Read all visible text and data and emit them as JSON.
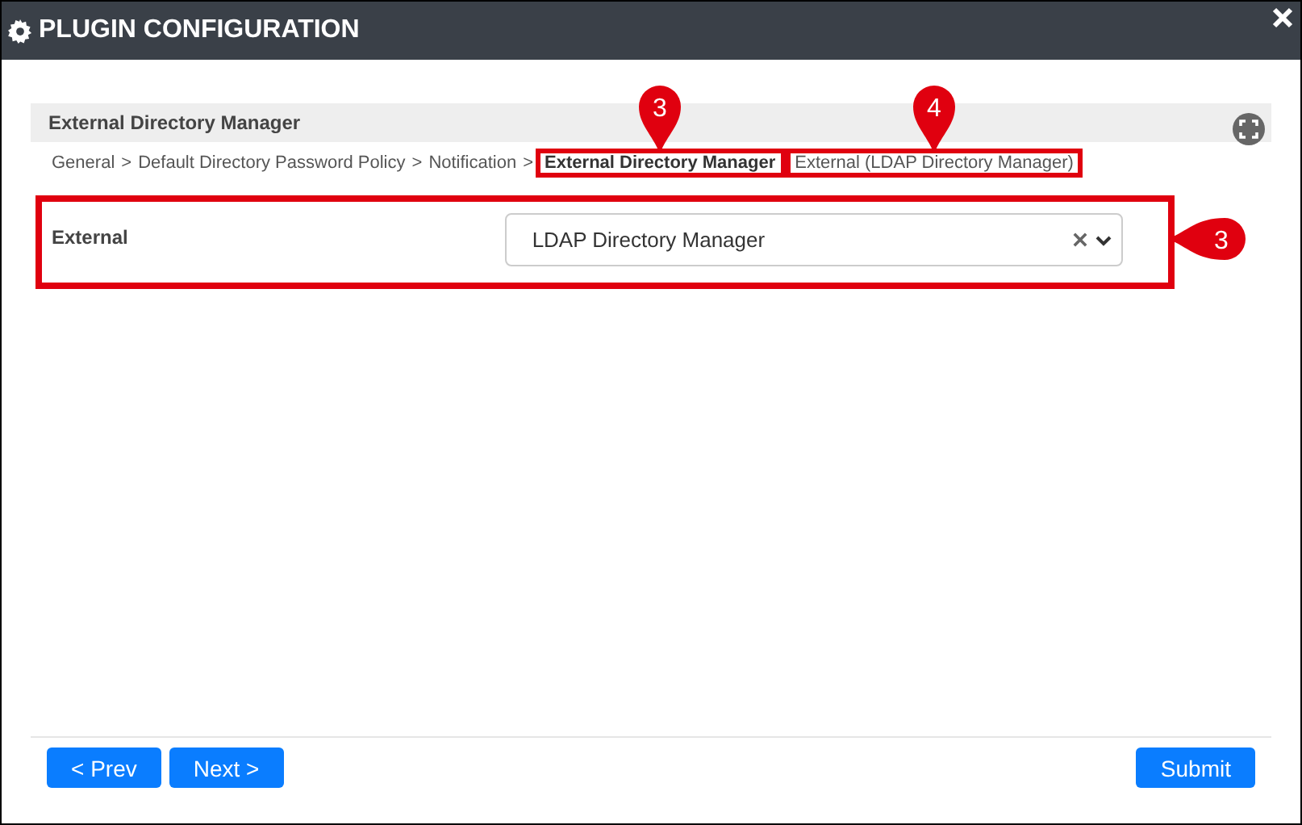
{
  "window": {
    "title": "PLUGIN CONFIGURATION"
  },
  "section": {
    "title": "External Directory Manager"
  },
  "breadcrumb": [
    {
      "label": "General",
      "current": false,
      "separator": ">"
    },
    {
      "label": "Default Directory Password Policy",
      "current": false,
      "separator": ">"
    },
    {
      "label": "Notification",
      "current": false,
      "separator": ">"
    },
    {
      "label": "External Directory Manager",
      "current": true,
      "callout": "3"
    },
    {
      "label": "External (LDAP Directory Manager)",
      "current": false,
      "callout": "4"
    }
  ],
  "field": {
    "label": "External",
    "value": "LDAP Directory Manager",
    "callout": "3"
  },
  "nav_buttons": [
    {
      "label": "< Prev"
    },
    {
      "label": "Next >"
    }
  ],
  "submit": {
    "label": "Submit"
  }
}
